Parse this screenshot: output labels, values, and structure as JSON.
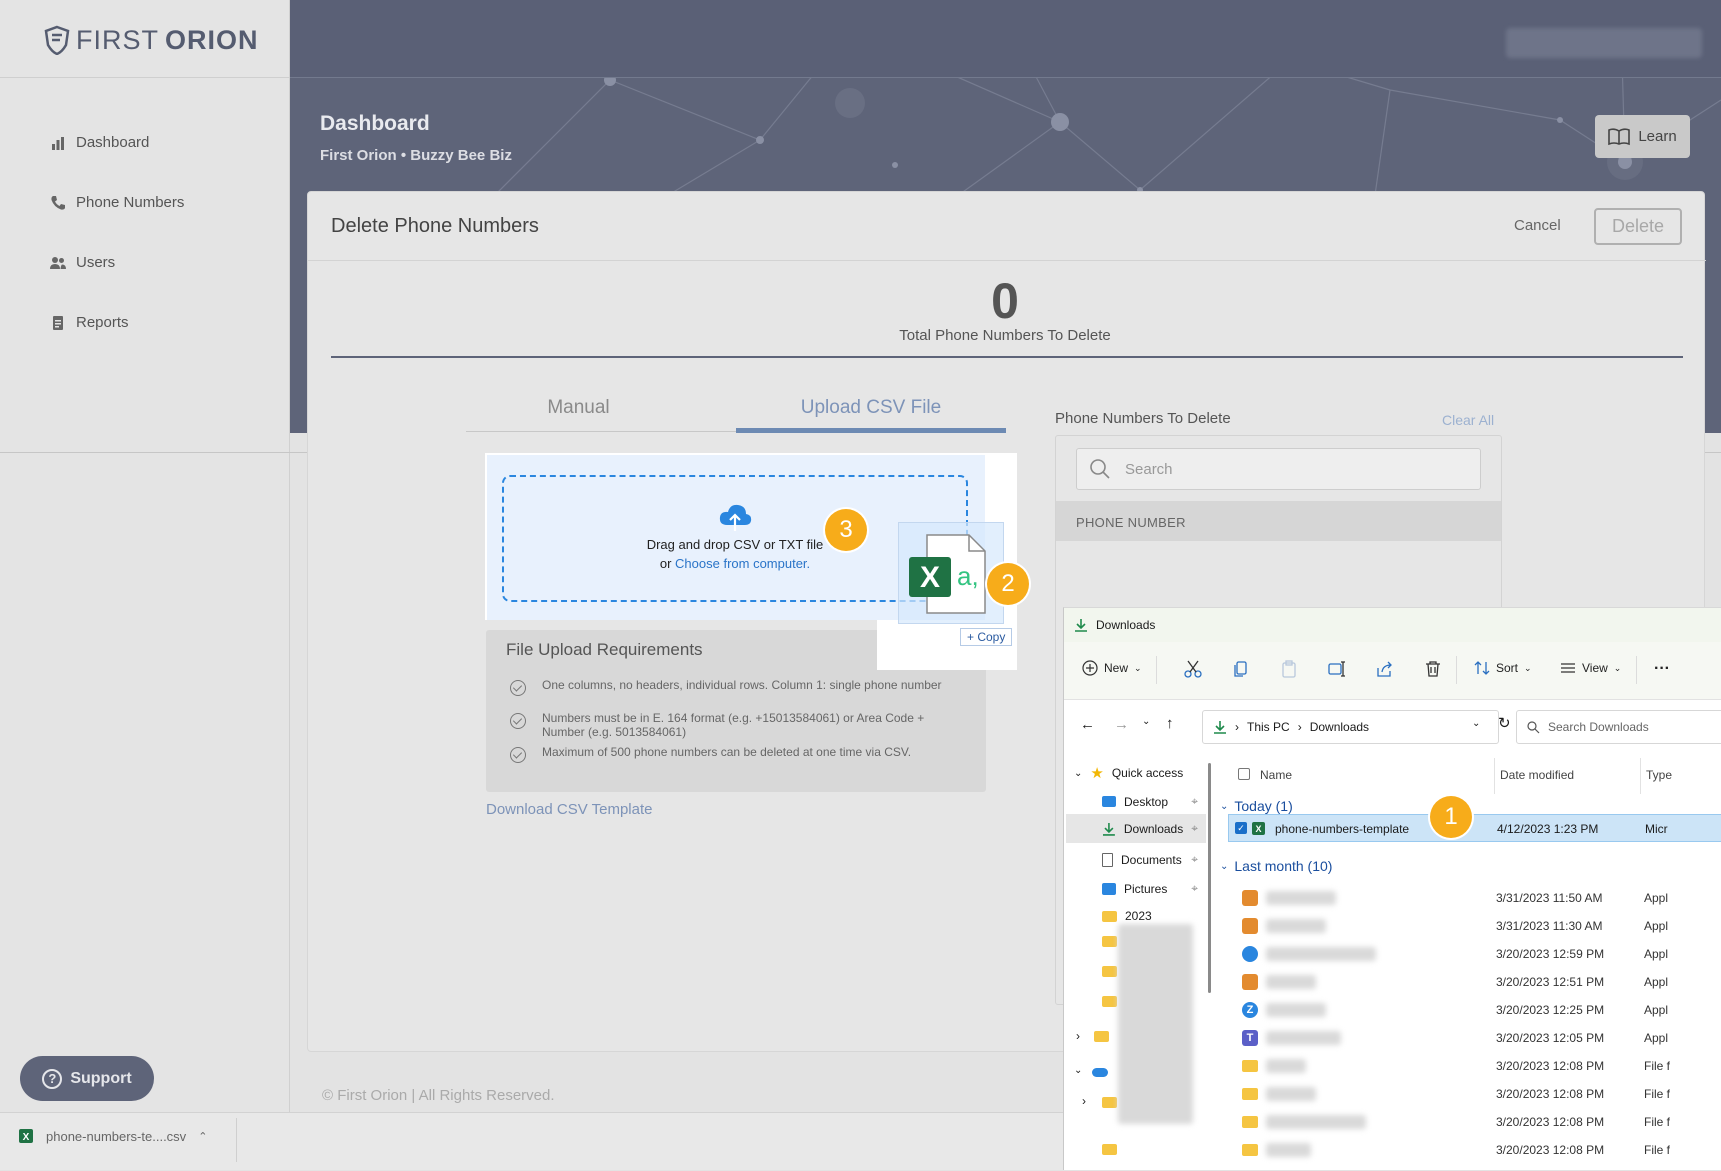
{
  "brand": {
    "word1": "FIRST",
    "word2": "ORION"
  },
  "sidebar": {
    "items": [
      {
        "label": "Dashboard",
        "icon": "bar-chart-icon"
      },
      {
        "label": "Phone Numbers",
        "icon": "phone-icon"
      },
      {
        "label": "Users",
        "icon": "users-icon"
      },
      {
        "label": "Reports",
        "icon": "report-icon"
      }
    ]
  },
  "header": {
    "title": "Dashboard",
    "subtitle": "First Orion • Buzzy Bee Biz",
    "learn_label": "Learn"
  },
  "modal": {
    "title": "Delete Phone Numbers",
    "cancel_label": "Cancel",
    "delete_label": "Delete",
    "count": "0",
    "count_label": "Total Phone Numbers To Delete",
    "tabs": [
      {
        "label": "Manual",
        "active": false
      },
      {
        "label": "Upload CSV File",
        "active": true
      }
    ],
    "dropzone": {
      "line1": "Drag and drop CSV or TXT file",
      "line2_prefix": "or",
      "choose_link": "Choose from computer."
    },
    "requirements": {
      "title": "File Upload Requirements",
      "items": [
        "One columns, no headers, individual rows. Column 1: single phone number",
        "Numbers must be in E. 164 format (e.g. +15013584061) or Area Code + Number (e.g. 5013584061)",
        "Maximum of 500 phone numbers can be deleted at one time via CSV."
      ]
    },
    "download_template": "Download CSV Template",
    "phone_panel": {
      "title": "Phone Numbers To Delete",
      "clear_all": "Clear All",
      "search_placeholder": "Search",
      "column_header": "PHONE NUMBER"
    }
  },
  "drag": {
    "copy_label": "+ Copy"
  },
  "badges": [
    "1",
    "2",
    "3"
  ],
  "support_label": "Support",
  "footer": "© First Orion | All Rights Reserved.",
  "download_bar": {
    "file": "phone-numbers-te....csv"
  },
  "explorer": {
    "title": "Downloads",
    "toolbar": {
      "new": "New",
      "sort": "Sort",
      "view": "View",
      "more": "···"
    },
    "address": {
      "root": "This PC",
      "folder": "Downloads"
    },
    "search_placeholder": "Search Downloads",
    "nav": {
      "quick_access": "Quick access",
      "items": [
        "Desktop",
        "Downloads",
        "Documents",
        "Pictures",
        "2023"
      ]
    },
    "columns": {
      "name": "Name",
      "date": "Date modified",
      "type": "Type"
    },
    "groups": {
      "today": "Today (1)",
      "last_month": "Last month (10)"
    },
    "today_file": {
      "name": "phone-numbers-template",
      "date": "4/12/2023 1:23 PM",
      "type": "Micr"
    },
    "older_files": [
      {
        "date": "3/31/2023 11:50 AM",
        "type": "Appl"
      },
      {
        "date": "3/31/2023 11:30 AM",
        "type": "Appl"
      },
      {
        "date": "3/20/2023 12:59 PM",
        "type": "Appl"
      },
      {
        "date": "3/20/2023 12:51 PM",
        "type": "Appl"
      },
      {
        "date": "3/20/2023 12:25 PM",
        "type": "Appl"
      },
      {
        "date": "3/20/2023 12:05 PM",
        "type": "Appl"
      },
      {
        "date": "3/20/2023 12:08 PM",
        "type": "File f"
      },
      {
        "date": "3/20/2023 12:08 PM",
        "type": "File f"
      },
      {
        "date": "3/20/2023 12:08 PM",
        "type": "File f"
      },
      {
        "date": "3/20/2023 12:08 PM",
        "type": "File f"
      }
    ]
  },
  "colors": {
    "header": "#5e6479",
    "link": "#2a74c8",
    "badge": "#f7ac1a",
    "excel": "#1f7244"
  }
}
